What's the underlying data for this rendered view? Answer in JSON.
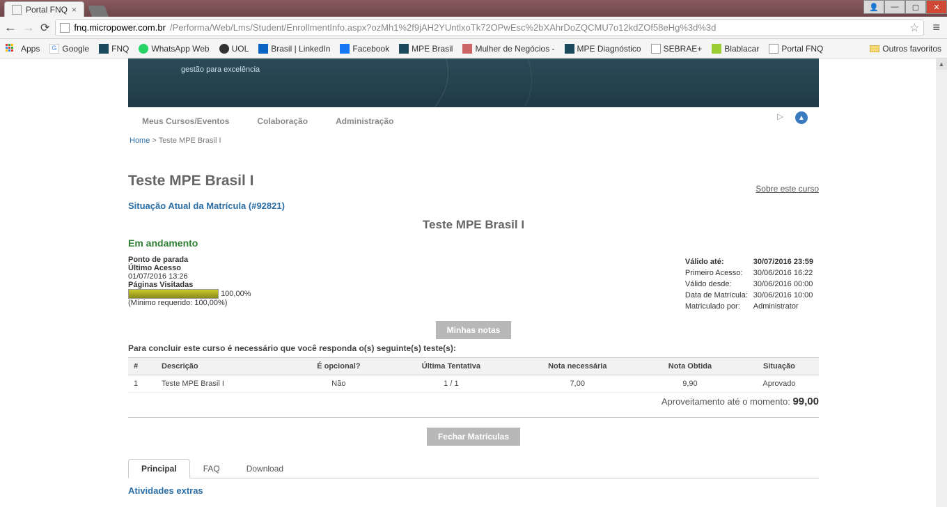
{
  "browser": {
    "tab_title": "Portal FNQ",
    "url_host": "fnq.micropower.com.br",
    "url_rest": "/Performa/Web/Lms/Student/EnrollmentInfo.aspx?ozMh1%2f9jAH2YUntlxoTk72OPwEsc%2bXAhrDoZQCMU7o12kdZOf58eHg%3d%3d",
    "apps": "Apps",
    "bookmarks": [
      "Google",
      "FNQ",
      "WhatsApp Web",
      "UOL",
      "Brasil | LinkedIn",
      "Facebook",
      "MPE Brasil",
      "Mulher de Negócios -",
      "MPE Diagnóstico",
      "SEBRAE+",
      "Blablacar",
      "Portal FNQ"
    ],
    "other_bookmarks": "Outros favoritos"
  },
  "banner": {
    "tagline": "gestão para excelência"
  },
  "topnav": {
    "items": [
      "Meus Cursos/Eventos",
      "Colaboração",
      "Administração"
    ]
  },
  "breadcrumb": {
    "home": "Home",
    "sep": " > ",
    "current": "Teste MPE Brasil I"
  },
  "page": {
    "title": "Teste MPE Brasil I",
    "about_link": "Sobre este curso",
    "enrollment_header": "Situação Atual da Matrícula (#92821)",
    "center_title": "Teste MPE Brasil I",
    "status": "Em andamento",
    "left": {
      "stop_label": "Ponto de parada",
      "last_access_label": "Último Acesso",
      "last_access_value": "01/07/2016 13:26",
      "pages_label": "Páginas Visitadas",
      "progress_pct": "100,00%",
      "min_req": "(Mínimo requerido: 100,00%)"
    },
    "right": {
      "rows": [
        {
          "k": "Válido até:",
          "v": "30/07/2016 23:59"
        },
        {
          "k": "Primeiro Acesso:",
          "v": "30/06/2016 16:22"
        },
        {
          "k": "Válido desde:",
          "v": "30/06/2016 00:00"
        },
        {
          "k": "Data de Matrícula:",
          "v": "30/06/2016 10:00"
        },
        {
          "k": "Matriculado por:",
          "v": "Administrator"
        }
      ]
    },
    "btn_my_grades": "Minhas notas",
    "instruction": "Para concluir este curso é necessário que você responda o(s) seguinte(s) teste(s):",
    "table": {
      "headers": [
        "#",
        "Descrição",
        "É opcional?",
        "Última Tentativa",
        "Nota necessária",
        "Nota Obtida",
        "Situação"
      ],
      "row": {
        "n": "1",
        "desc": "Teste MPE Brasil I",
        "opt": "Não",
        "att": "1 / 1",
        "need": "7,00",
        "got": "9,90",
        "stat": "Aprovado"
      }
    },
    "aprov_label": "Aproveitamento até o momento: ",
    "aprov_value": "99,00",
    "btn_close": "Fechar Matrículas",
    "tabs": [
      "Principal",
      "FAQ",
      "Download"
    ],
    "extras": "Atividades extras"
  }
}
